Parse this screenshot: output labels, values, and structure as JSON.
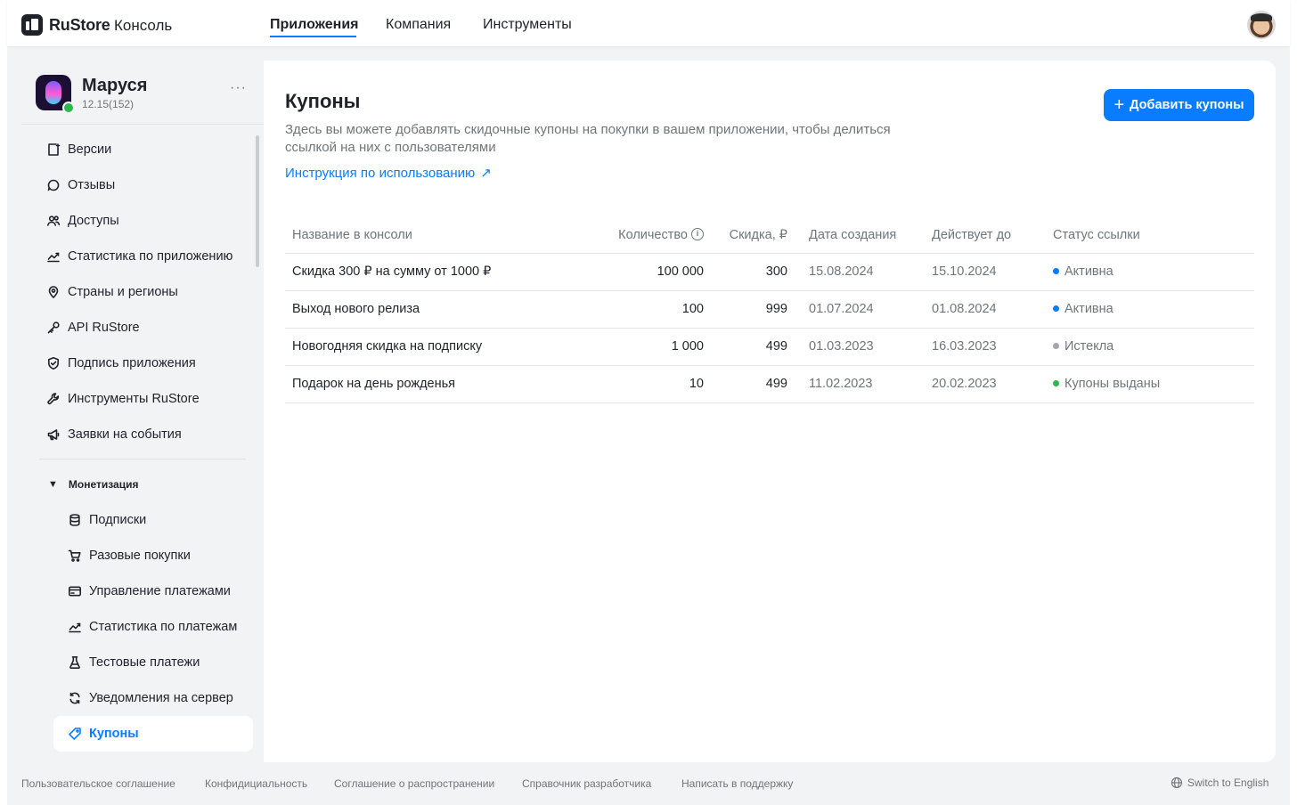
{
  "topbar": {
    "brand": "RuStore",
    "brand_suffix": "Консоль",
    "nav": [
      "Приложения",
      "Компания",
      "Инструменты"
    ]
  },
  "app": {
    "name": "Маруся",
    "version": "12.15(152)",
    "more": "···"
  },
  "menu": [
    {
      "label": "Версии",
      "icon": "versions-icon"
    },
    {
      "label": "Отзывы",
      "icon": "chat-icon"
    },
    {
      "label": "Доступы",
      "icon": "users-icon"
    },
    {
      "label": "Статистика по приложению",
      "icon": "chart-icon"
    },
    {
      "label": "Страны и регионы",
      "icon": "location-icon"
    },
    {
      "label": "API RuStore",
      "icon": "key-icon"
    },
    {
      "label": "Подпись приложения",
      "icon": "shield-icon"
    },
    {
      "label": "Инструменты RuStore",
      "icon": "wrench-icon"
    },
    {
      "label": "Заявки на события",
      "icon": "megaphone-icon"
    }
  ],
  "monetization": {
    "title": "Монетизация",
    "items": [
      {
        "label": "Подписки",
        "icon": "database-icon"
      },
      {
        "label": "Разовые покупки",
        "icon": "cart-icon"
      },
      {
        "label": "Управление платежами",
        "icon": "card-icon"
      },
      {
        "label": "Статистика по платежам",
        "icon": "chart-icon"
      },
      {
        "label": "Тестовые платежи",
        "icon": "flask-icon"
      },
      {
        "label": "Уведомления на сервер",
        "icon": "bell-sync-icon"
      },
      {
        "label": "Купоны",
        "icon": "coupon-icon"
      }
    ]
  },
  "page": {
    "title": "Купоны",
    "description": "Здесь вы можете добавлять скидочные купоны на покупки в вашем приложении, чтобы делиться ссылкой на них с пользователями",
    "guide_link": "Инструкция по использованию",
    "add_button": "Добавить купоны"
  },
  "table": {
    "headers": [
      "Название в консоли",
      "Количество",
      "Скидка, ₽",
      "Дата создания",
      "Действует до",
      "Статус ссылки"
    ],
    "rows": [
      {
        "name": "Скидка 300 ₽ на сумму от 1000 ₽",
        "qty": "100 000",
        "discount": "300",
        "created": "15.08.2024",
        "until": "15.10.2024",
        "status": "Активна",
        "status_color": "#0a7cff"
      },
      {
        "name": "Выход нового релиза",
        "qty": "100",
        "discount": "999",
        "created": "01.07.2024",
        "until": "01.08.2024",
        "status": "Активна",
        "status_color": "#0a7cff"
      },
      {
        "name": "Новогодняя скидка на подписку",
        "qty": "1 000",
        "discount": "499",
        "created": "01.03.2023",
        "until": "16.03.2023",
        "status": "Истекла",
        "status_color": "#a3a7ad"
      },
      {
        "name": "Подарок на день рожденья",
        "qty": "10",
        "discount": "499",
        "created": "11.02.2023",
        "until": "20.02.2023",
        "status": "Купоны выданы",
        "status_color": "#2db84d"
      }
    ]
  },
  "footer": {
    "links": [
      "Пользовательское соглашение",
      "Конфидициальность",
      "Соглашение о распространении",
      "Справочник разработчика",
      "Написать в поддержку"
    ],
    "lang": "Switch to English"
  }
}
